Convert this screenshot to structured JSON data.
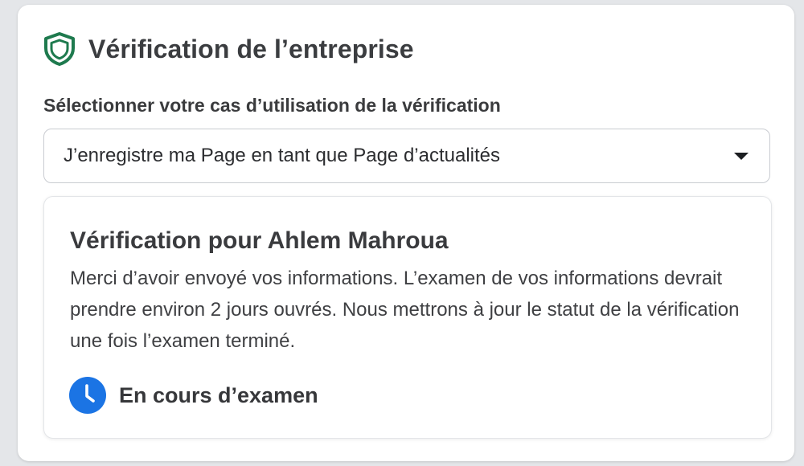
{
  "header": {
    "title": "Vérification de l’entreprise",
    "icon": "shield-icon",
    "icon_color": "#1e7a4e"
  },
  "use_case": {
    "label": "Sélectionner votre cas d’utilisation de la vérification",
    "selected_value": "J’enregistre ma Page en tant que Page d’actualités"
  },
  "verification_card": {
    "title": "Vérification pour Ahlem Mahroua",
    "body": "Merci d’avoir envoyé vos informations. L’examen de vos informations devrait prendre environ 2 jours ouvrés. Nous mettrons à jour le statut de la vérification une fois l’examen terminé.",
    "status_icon": "clock-icon",
    "status_color": "#1b74e4",
    "status_text": "En cours d’examen"
  }
}
